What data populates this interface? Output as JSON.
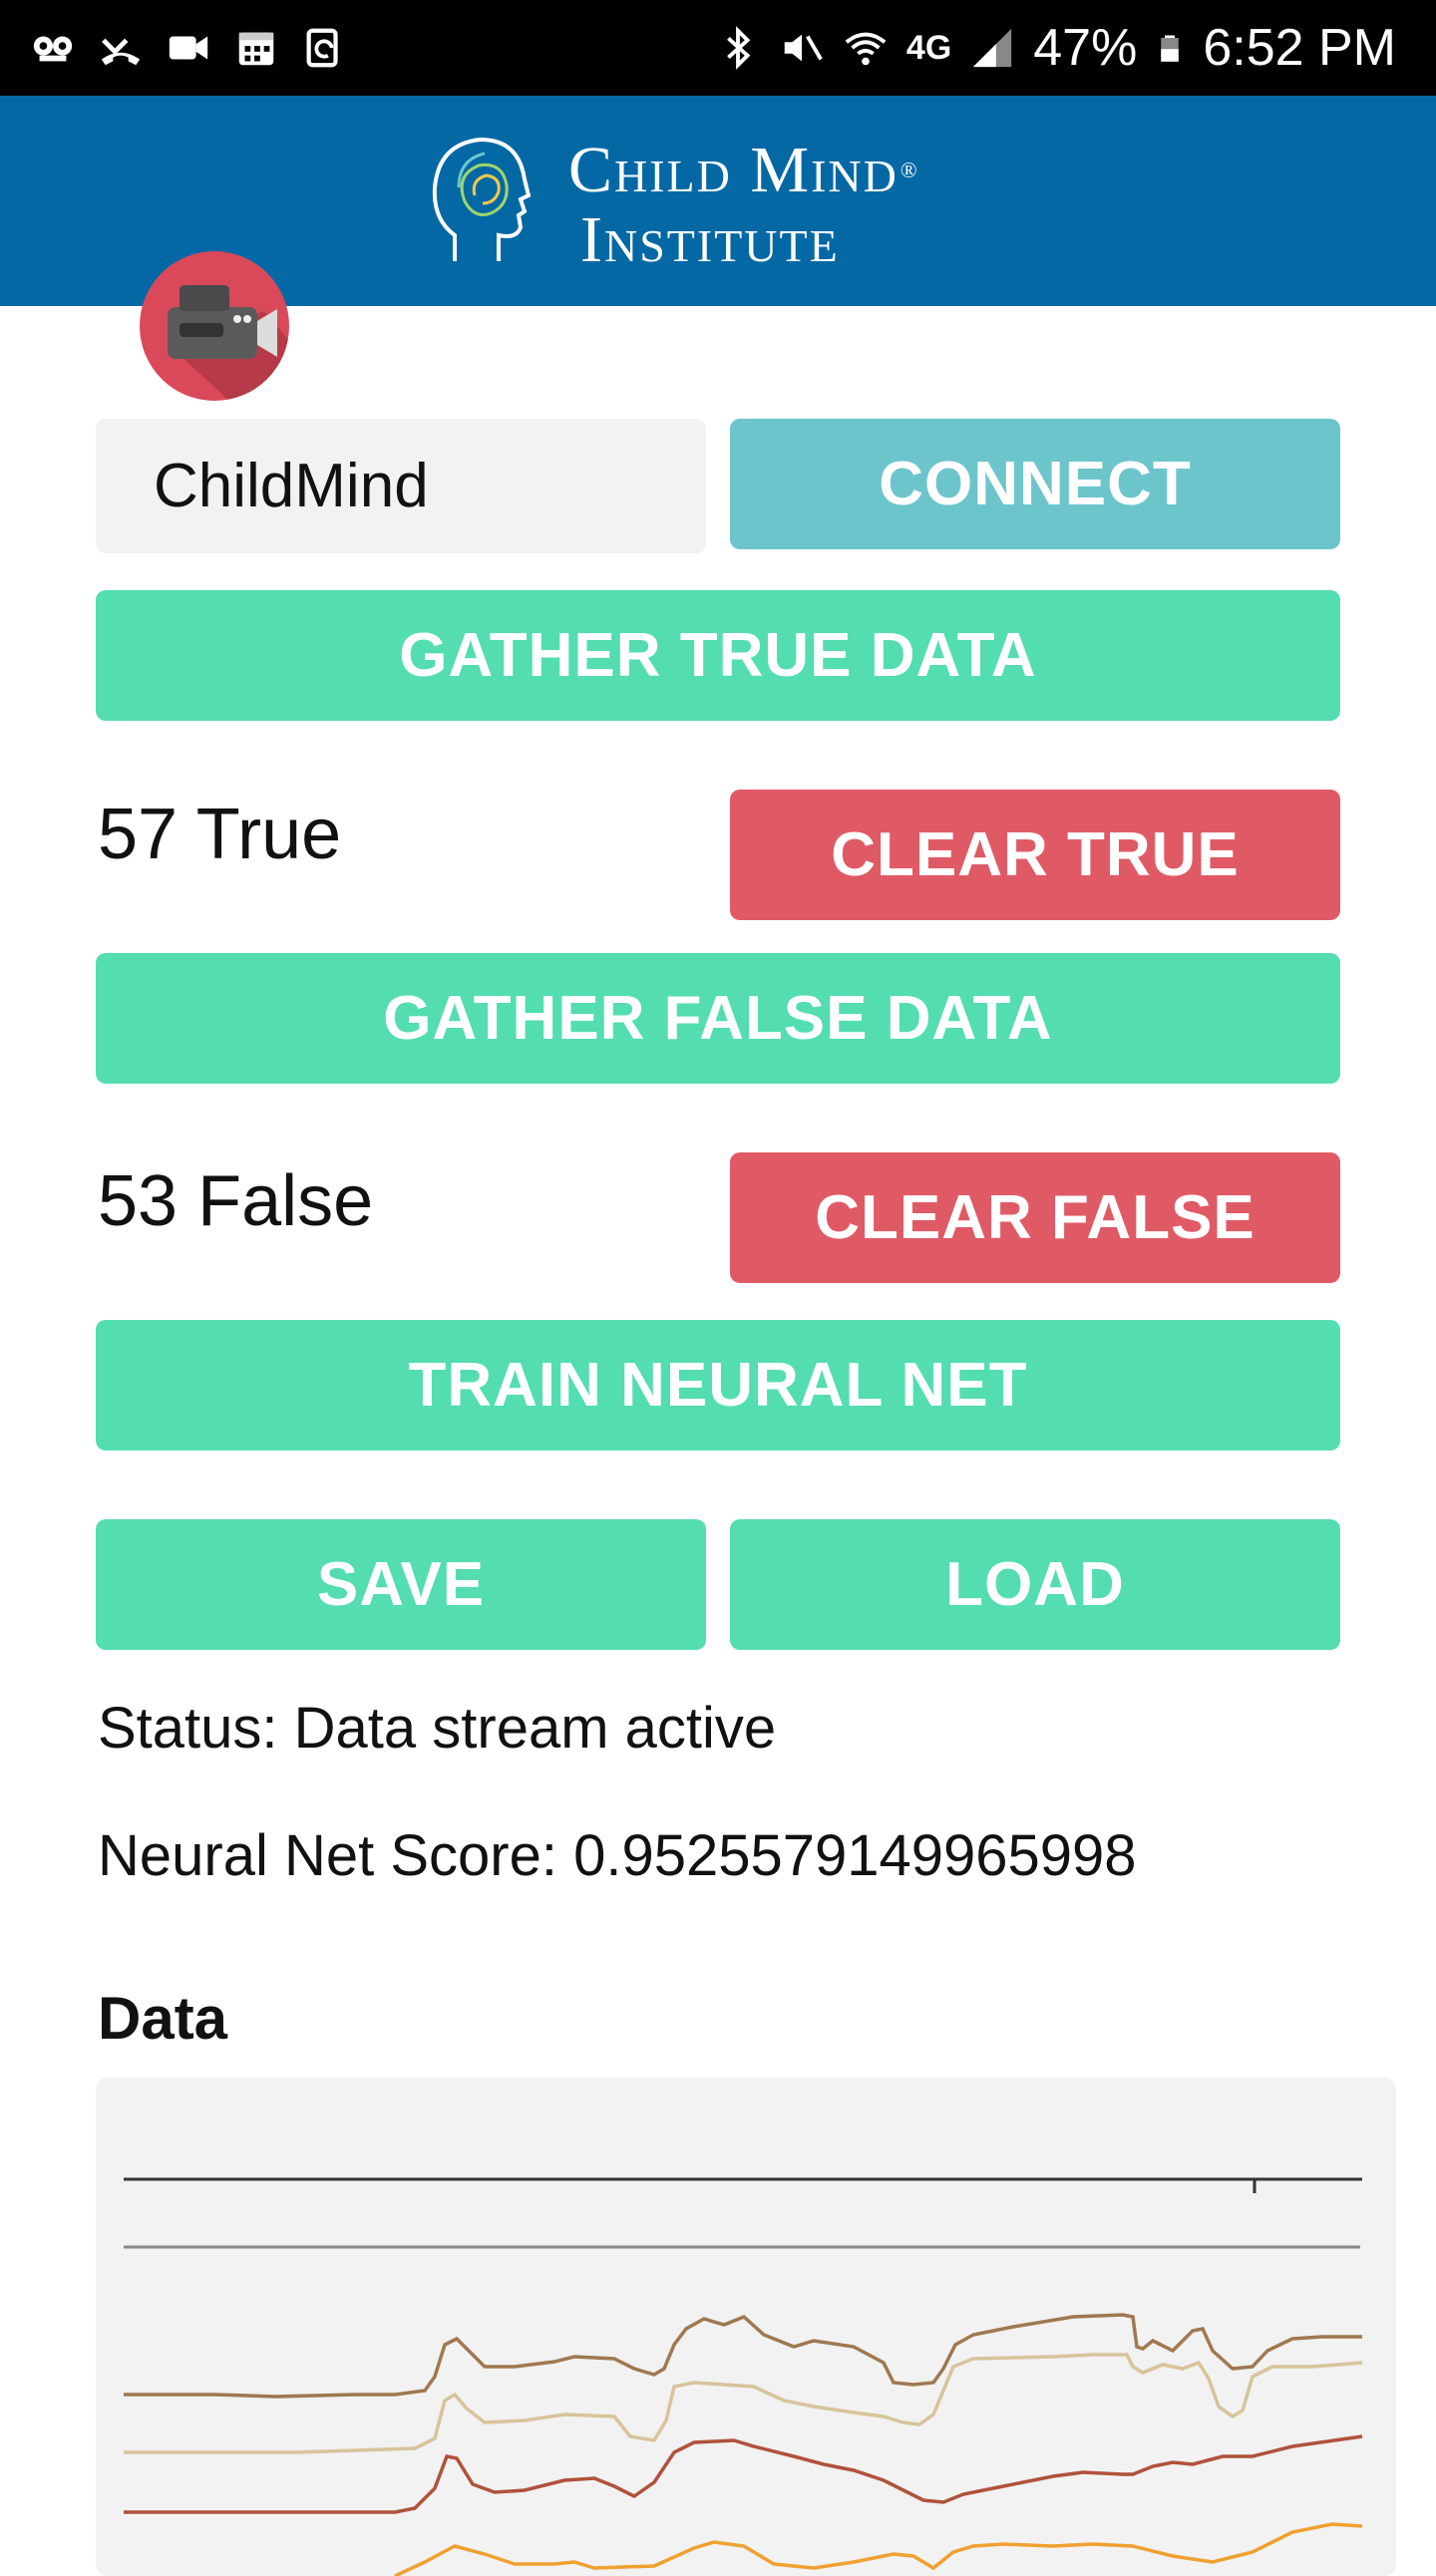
{
  "status_bar": {
    "battery": "47%",
    "time": "6:52 PM",
    "network": "4G",
    "left_icons": [
      "voicemail-icon",
      "missed-call-icon",
      "video-call-icon",
      "calendar-icon",
      "sync-icon"
    ],
    "right_icons": [
      "bluetooth-icon",
      "mute-icon",
      "wifi-icon",
      "signal-icon",
      "battery-icon"
    ]
  },
  "header": {
    "brand_line1": "Child Mind",
    "brand_line2": "Institute",
    "trademark": "®",
    "logo_icon": "head-profile-icon"
  },
  "app_icon": "video-camera-icon",
  "device_input": {
    "value": "ChildMind"
  },
  "buttons": {
    "connect": "CONNECT",
    "gather_true": "GATHER TRUE DATA",
    "clear_true": "CLEAR TRUE",
    "gather_false": "GATHER FALSE DATA",
    "clear_false": "CLEAR FALSE",
    "train": "TRAIN NEURAL NET",
    "save": "SAVE",
    "load": "LOAD"
  },
  "counts": {
    "true_label": "57 True",
    "false_label": "53 False"
  },
  "status_text": "Status: Data stream active",
  "score_text": "Neural Net Score: 0.9525579149965998",
  "data_section": {
    "title": "Data"
  },
  "colors": {
    "header_blue": "#0468a5",
    "teal": "#6cc5cb",
    "green": "#53ddb0",
    "red": "#e05a66",
    "trace_dark": "#333333",
    "trace_grey": "#888888",
    "trace_brown": "#a07850",
    "trace_tan": "#d8c49a",
    "trace_rust": "#b0523a",
    "trace_orange": "#f0a030"
  }
}
